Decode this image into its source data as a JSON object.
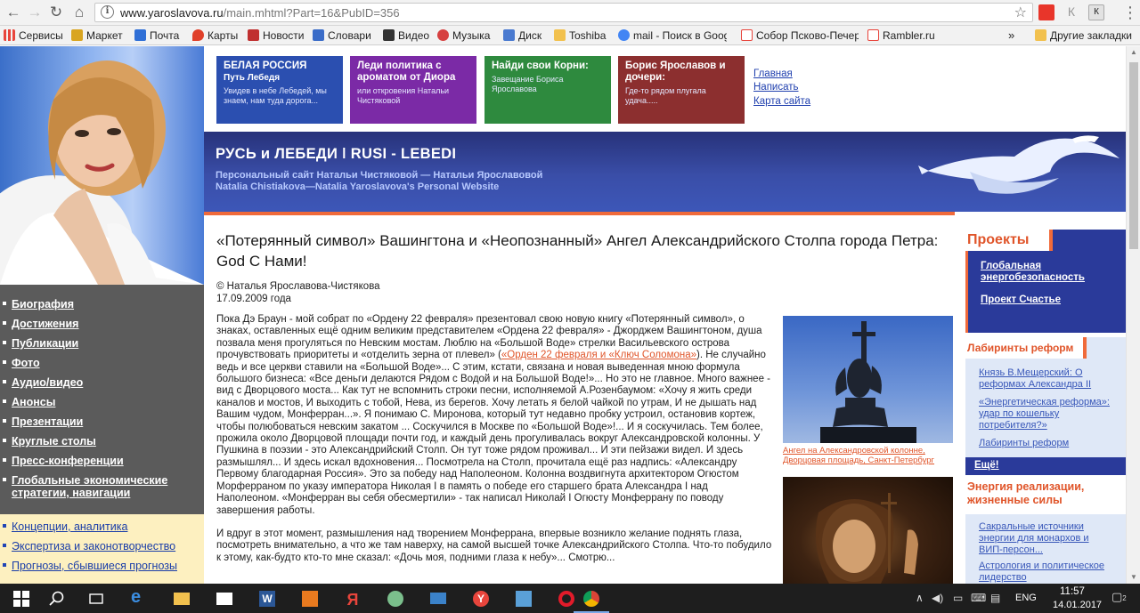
{
  "browser": {
    "url_host": "www.yaroslavova.ru",
    "url_path": "/main.mhtml?Part=16&PubID=356",
    "bookmarks": [
      {
        "label": "Сервисы",
        "color": "#e8453c"
      },
      {
        "label": "Маркет",
        "color": "#d9a520"
      },
      {
        "label": "Почта",
        "color": "#2f6fd6"
      },
      {
        "label": "Карты",
        "color": "#e0402a"
      },
      {
        "label": "Новости",
        "color": "#c03030"
      },
      {
        "label": "Словари",
        "color": "#3a6cc8"
      },
      {
        "label": "Видео",
        "color": "#333333"
      },
      {
        "label": "Музыка",
        "color": "#d64040"
      },
      {
        "label": "Диск",
        "color": "#4a7ad0"
      },
      {
        "label": "Toshiba",
        "color": "#f2c14e"
      },
      {
        "label": "mail - Поиск в Google",
        "color": "#4285f4"
      },
      {
        "label": "Собор Псково-Печер",
        "color": "#e8453c"
      },
      {
        "label": "Rambler.ru",
        "color": "#4a7ad0"
      }
    ],
    "overflow_label": "»",
    "other_bookmarks": "Другие закладки"
  },
  "sidebar": {
    "nav": [
      "Биография",
      "Достижения",
      "Публикации",
      "Фото",
      "Аудио/видео",
      "Анонсы",
      "Презентации",
      "Круглые столы",
      "Пресс-конференции",
      "Глобальные экономические стратегии, навигации"
    ],
    "nav_yellow": [
      "Концепции, аналитика",
      "Экспертиза и законотворчество",
      "Прогнозы, сбывшиеся прогнозы"
    ]
  },
  "header": {
    "boxes": [
      {
        "title": "БЕЛАЯ РОССИЯ",
        "subtitle": "Путь Лебедя",
        "desc": "Увидев в небе Лебедей, мы знаем, нам туда дорога...",
        "color": "#2b4fb0"
      },
      {
        "title": "Леди политика с ароматом от Диора",
        "subtitle": "",
        "desc": "или откровения Натальи Чистяковой",
        "color": "#7b2aa6"
      },
      {
        "title": "Найди свои Корни:",
        "subtitle": "",
        "desc": "Завещание Бориса Ярославова",
        "color": "#2e8a3e"
      },
      {
        "title": "Борис Ярославов и дочери:",
        "subtitle": "",
        "desc": "Где-то рядом плугала удача.....",
        "color": "#8c2f2f"
      }
    ],
    "links": [
      "Главная",
      "Написать",
      "Карта сайта"
    ],
    "banner_title": "РУСЬ и ЛЕБЕДИ ǀ RUSI - LEBEDI",
    "banner_sub1": "Персональный сайт Натальи Чистяковой — Натальи Ярославовой",
    "banner_sub2": "Natalia Chistiakova—Natalia Yaroslavova's  Personal Website"
  },
  "article": {
    "title": "«Потерянный символ» Вашингтона и «Неопознанный» Ангел Александрийского Столпа города Петра: God С Нами!",
    "author": "© Наталья Ярославова-Чистякова",
    "date": "17.09.2009 года",
    "p1_a": "Пока Дэ Браун - мой собрат по «Ордену 22 февраля» презентовал свою новую книгу «Потерянный символ», о знаках, оставленных ещё одним великим представителем «Ордена 22 февраля» - Джорджем Вашингтоном, душа позвала меня прогуляться по Невским мостам. Люблю на «Большой Воде» стрелки Васильевского острова прочувствовать приоритеты и «отделить зерна от плевел» (",
    "p1_link": "«Орден 22 февраля и «Ключ Соломона»",
    "p1_b": "). Не случайно ведь и все церкви ставили на «Большой Воде»... С этим, кстати, связана и новая выведенная мною формула большого бизнеса: «Все деньги делаются Рядом с Водой и на Большой Воде!»... Но это не главное. Много важнее - вид с Дворцового моста... Как тут не вспомнить строки песни, исполняемой А.Розенбаумом: «Хочу я жить среди каналов и мостов, И выходить с тобой, Нева, из берегов. Хочу летать я белой чайкой по утрам, И не дышать над Вашим чудом, Монферран...». Я понимаю С. Миронова, который тут недавно пробку устроил, остановив кортеж, чтобы полюбоваться невским закатом ... Соскучился в Москве по «Большой Воде»!... И я соскучилась. Тем более, прожила около Дворцовой площади почти год, и каждый день прогуливалась вокруг Александровской колонны. У Пушкина в поэзии - это Александрийский Столп. Он тут тоже рядом проживал... И эти пейзажи видел. И здесь размышлял... И здесь искал вдохновения... Посмотрела на Столп, прочитала ещё раз надпись: «Александру Первому благодарная Россия». Это за победу над Наполеоном. Колонна воздвигнута архитектором Огюстом Морферраном по указу императора Николая I в память о победе его старшего брата Александра I над Наполеоном. «Монферран вы себя обесмертили» - так написал Николай I Огюсту Монферрану по поводу завершения работы.",
    "p2": "И вдруг в этот момент, размышления над творением Монферрана, впервые возникло желание поднять глаза, посмотреть внимательно, а что же там наверху, на самой высшей точке Александрийского Столпа. Что-то побудило к этому, как-будто кто-то мне сказал: «Дочь моя, подними глаза к небу»... Смотрю...",
    "img1_caption": "Ангел на Александровской колонне, Дворцовая площадь, Санкт-Петербург"
  },
  "right": {
    "projects_title": "Проекты",
    "projects": [
      "Глобальная энергобезопасность",
      "Проект Счастье"
    ],
    "sec1_title": "Лабиринты реформ",
    "sec1_links": [
      "Князь В.Мещерский: О реформах Александра II",
      "«Энергетическая реформа»: удар по кошельку потребителя?»",
      "Лабиринты реформ"
    ],
    "sec1_more": "Ещё!",
    "sec2_title": "Энергия реализации, жизненные силы",
    "sec2_links": [
      "Сакральные источники энергии для монархов и ВИП-персон...",
      "Астрология и политическое лидерство"
    ]
  },
  "taskbar": {
    "lang": "ENG",
    "time": "11:57",
    "date": "14.01.2017",
    "notifications": "2"
  }
}
